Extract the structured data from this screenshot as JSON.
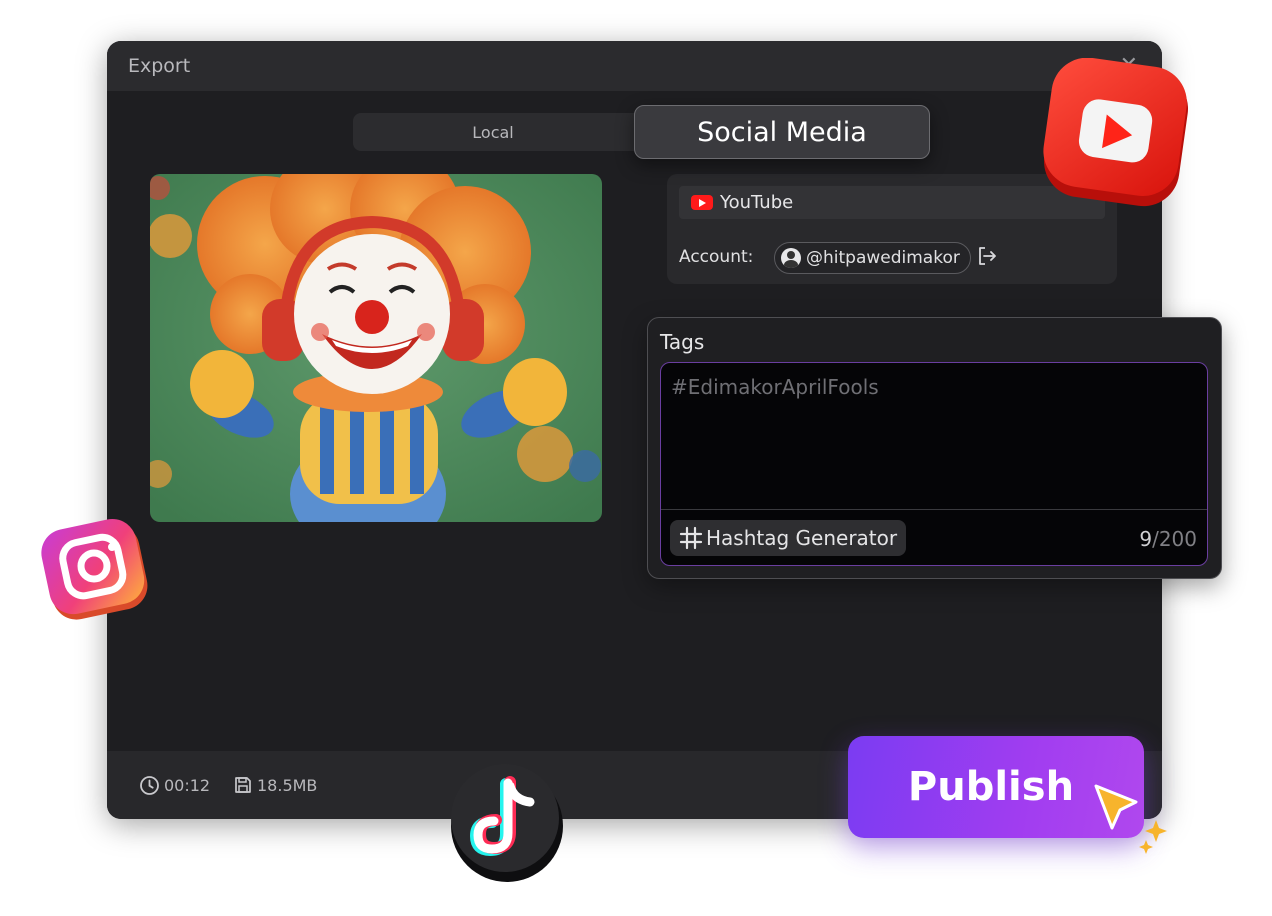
{
  "dialog": {
    "title": "Export",
    "close_icon": "close-icon"
  },
  "tabs": {
    "local_label": "Local",
    "social_label": "Social Media",
    "active": "Social Media"
  },
  "platform": {
    "name": "YouTube",
    "icon": "youtube-icon",
    "account_label": "Account:",
    "account_handle": "@hitpawedimakor",
    "logout_icon": "logout-icon"
  },
  "tags": {
    "label": "Tags",
    "value": "#EdimakorAprilFools",
    "generator_label": "Hashtag Generator",
    "count": "9",
    "max": "/200"
  },
  "footer": {
    "duration": "00:12",
    "size": "18.5MB"
  },
  "publish": {
    "label": "Publish"
  },
  "colors": {
    "accent_gradient_start": "#7b3cf2",
    "accent_gradient_end": "#b048ee",
    "youtube_red": "#ff1a1a",
    "dialog_bg": "#1e1e21"
  },
  "decorations": [
    "youtube-logo-3d",
    "instagram-logo-3d",
    "tiktok-logo-3d",
    "cursor-arrow-icon"
  ]
}
